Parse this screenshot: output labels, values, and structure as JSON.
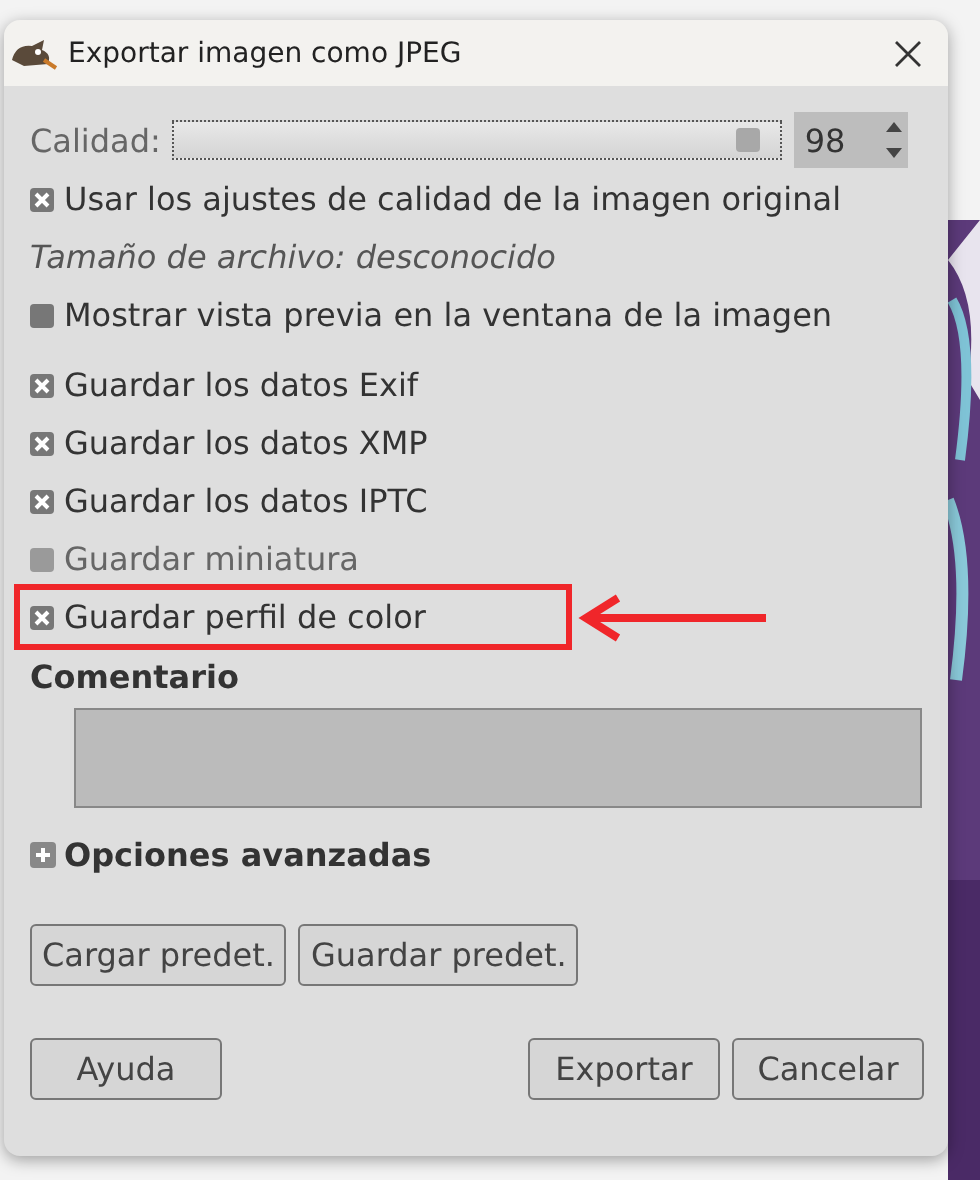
{
  "window": {
    "title": "Exportar imagen como JPEG"
  },
  "quality": {
    "label": "Calidad:",
    "level": 0.98,
    "value": "98"
  },
  "options": [
    {
      "kind": "checkbox",
      "label": "Usar los ajustes de calidad de la imagen original",
      "checked": true,
      "disabled": false,
      "highlighted": false
    },
    {
      "kind": "info",
      "label": "Tamaño de archivo: desconocido"
    },
    {
      "kind": "checkbox",
      "label": "Mostrar vista previa en la ventana de la imagen",
      "checked": false,
      "disabled": false,
      "highlighted": false
    },
    {
      "kind": "checkbox",
      "label": "Guardar los datos Exif",
      "checked": true,
      "disabled": false,
      "highlighted": false
    },
    {
      "kind": "checkbox",
      "label": "Guardar los datos XMP",
      "checked": true,
      "disabled": false,
      "highlighted": false
    },
    {
      "kind": "checkbox",
      "label": "Guardar los datos IPTC",
      "checked": true,
      "disabled": false,
      "highlighted": false
    },
    {
      "kind": "checkbox",
      "label": "Guardar miniatura",
      "checked": false,
      "disabled": true,
      "highlighted": false
    },
    {
      "kind": "checkbox",
      "label": "Guardar perfil de color",
      "checked": true,
      "disabled": false,
      "highlighted": true
    }
  ],
  "comment": {
    "label": "Comentario"
  },
  "advanced": {
    "label": "Opciones avanzadas",
    "expanded": false
  },
  "preset_buttons": [
    "Cargar predet.",
    "Guardar predet."
  ],
  "help_button": "Ayuda",
  "action_buttons": [
    "Exportar",
    "Cancelar"
  ]
}
